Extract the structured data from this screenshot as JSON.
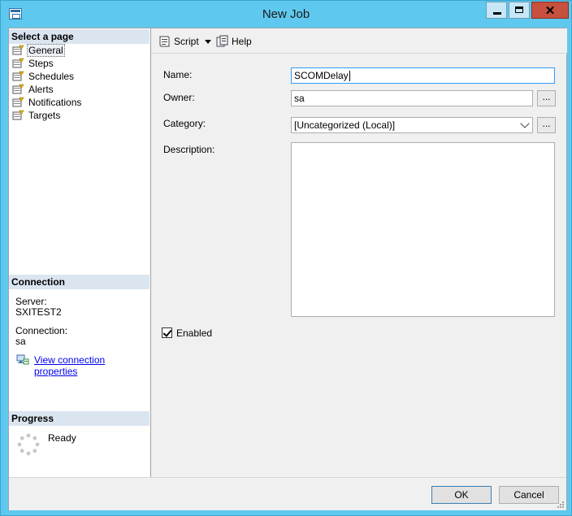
{
  "window": {
    "title": "New Job"
  },
  "leftpane": {
    "select_page_header": "Select a page",
    "pages": [
      {
        "label": "General",
        "icon": "page-icon"
      },
      {
        "label": "Steps",
        "icon": "page-icon"
      },
      {
        "label": "Schedules",
        "icon": "page-icon"
      },
      {
        "label": "Alerts",
        "icon": "page-icon"
      },
      {
        "label": "Notifications",
        "icon": "page-icon"
      },
      {
        "label": "Targets",
        "icon": "page-icon"
      }
    ],
    "connection_header": "Connection",
    "server_label": "Server:",
    "server_value": "SXITEST2",
    "connection_label": "Connection:",
    "connection_value": "sa",
    "view_connection_link": "View connection properties",
    "progress_header": "Progress",
    "progress_status": "Ready"
  },
  "toolbar": {
    "script_label": "Script",
    "help_label": "Help"
  },
  "form": {
    "name_label": "Name:",
    "name_value": "SCOMDelay",
    "owner_label": "Owner:",
    "owner_value": "sa",
    "category_label": "Category:",
    "category_value": "[Uncategorized (Local)]",
    "description_label": "Description:",
    "description_value": "",
    "enabled_label": "Enabled",
    "ellipsis_label": "..."
  },
  "buttons": {
    "ok_label": "OK",
    "cancel_label": "Cancel"
  },
  "colors": {
    "titlebar": "#5fc8ef",
    "close": "#c7503f",
    "section_header": "#dbe5f0",
    "link": "#0000ee"
  }
}
